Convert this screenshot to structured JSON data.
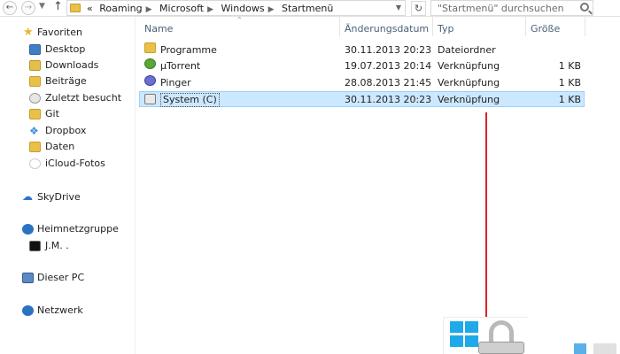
{
  "address_bar": {
    "back_icon": "arrow-left-icon",
    "forward_icon": "arrow-right-icon",
    "up_icon": "arrow-up-icon",
    "overflow": "«",
    "crumbs": [
      "Roaming",
      "Microsoft",
      "Windows",
      "Startmenü"
    ],
    "search_placeholder": "\"Startmenü\" durchsuchen"
  },
  "sidebar": {
    "favorites_label": "Favoriten",
    "favorites": [
      {
        "label": "Desktop",
        "icon": "desktop-icon"
      },
      {
        "label": "Downloads",
        "icon": "downloads-icon"
      },
      {
        "label": "Beiträge",
        "icon": "folder-icon"
      },
      {
        "label": "Zuletzt besucht",
        "icon": "recent-icon"
      },
      {
        "label": "Git",
        "icon": "folder-icon"
      },
      {
        "label": "Dropbox",
        "icon": "dropbox-icon"
      },
      {
        "label": "Daten",
        "icon": "folder-icon"
      },
      {
        "label": "iCloud-Fotos",
        "icon": "icloud-icon"
      }
    ],
    "skydrive": "SkyDrive",
    "homegroup": "Heimnetzgruppe",
    "homegroup_user": "J.M. .",
    "pc": "Dieser PC",
    "network": "Netzwerk"
  },
  "columns": {
    "name": "Name",
    "date": "Änderungsdatum",
    "type": "Typ",
    "size": "Größe"
  },
  "files": [
    {
      "name": "Programme",
      "date": "30.11.2013 20:23",
      "type": "Dateiordner",
      "size": "",
      "icon": "folder-icon"
    },
    {
      "name": "µTorrent",
      "date": "19.07.2013 20:14",
      "type": "Verknüpfung",
      "size": "1 KB",
      "icon": "utorrent-icon"
    },
    {
      "name": "Pinger",
      "date": "28.08.2013 21:45",
      "type": "Verknüpfung",
      "size": "1 KB",
      "icon": "pinger-icon"
    },
    {
      "name": "System (C)",
      "date": "30.11.2013 20:23",
      "type": "Verknüpfung",
      "size": "1 KB",
      "icon": "system-shortcut-icon",
      "selected": true
    }
  ],
  "colors": {
    "selection_bg": "#cce8ff",
    "selection_border": "#99d1ff",
    "annotation_line": "#e02020",
    "column_header": "#4c607a"
  }
}
